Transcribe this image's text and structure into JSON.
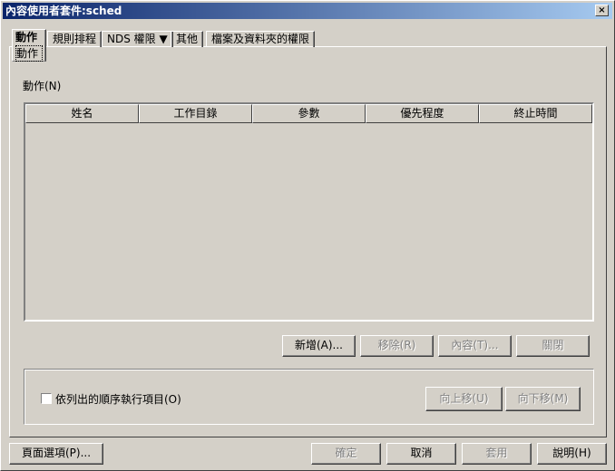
{
  "title": "內容使用者套件:sched",
  "close_label": "×",
  "tabs": [
    {
      "label": "動作",
      "sublabel": "動作"
    },
    {
      "label": "規則排程"
    },
    {
      "label": "NDS 權限 ▼"
    },
    {
      "label": "其他"
    },
    {
      "label": "檔案及資料夾的權限"
    }
  ],
  "actions_label": "動作(N)",
  "columns": [
    "姓名",
    "工作目錄",
    "參數",
    "優先程度",
    "終止時間"
  ],
  "rows": [],
  "buttons": {
    "add": "新增(A)...",
    "remove": "移除(R)",
    "properties": "內容(T)...",
    "close": "關閉",
    "move_up": "向上移(U)",
    "move_down": "向下移(M)"
  },
  "checkbox": {
    "label": "依列出的順序執行項目(O)",
    "checked": false
  },
  "footer": {
    "page_options": "頁面選項(P)...",
    "ok": "確定",
    "cancel": "取消",
    "apply": "套用",
    "help": "說明(H)"
  }
}
